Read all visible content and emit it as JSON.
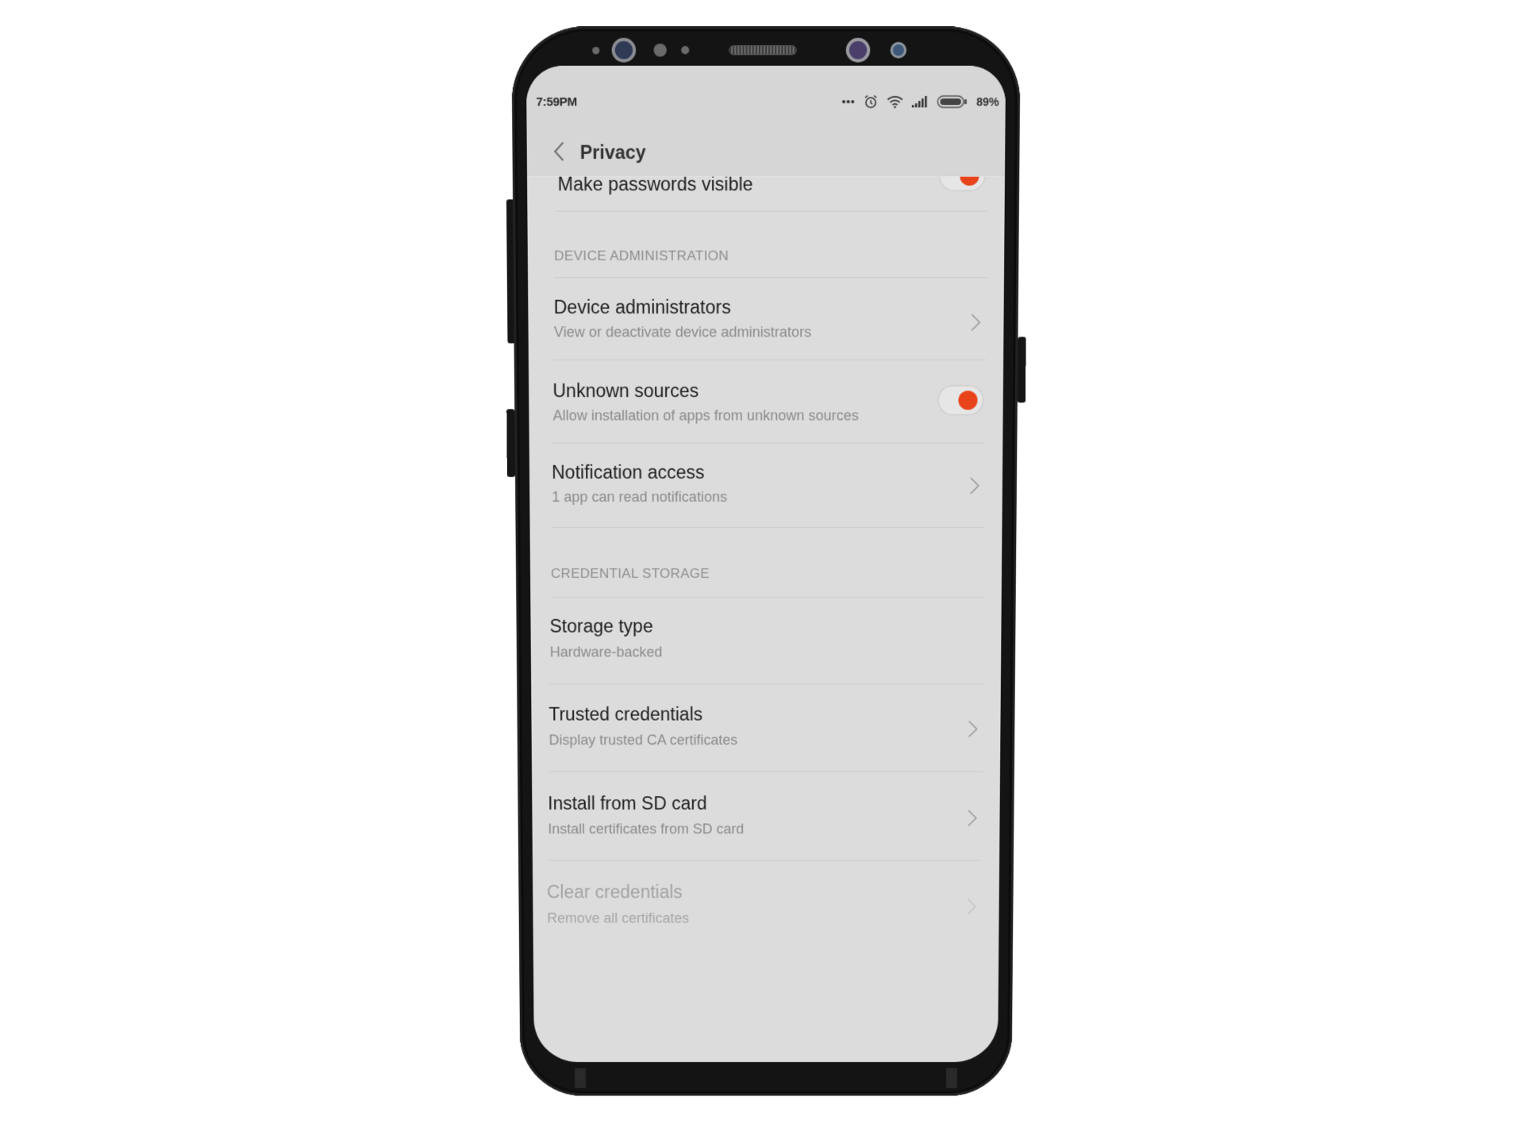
{
  "status_bar": {
    "time": "7:59PM",
    "icons": [
      "more-dots-icon",
      "alarm-icon",
      "wifi-icon",
      "signal-icon",
      "battery-icon"
    ],
    "battery_percent": "89%"
  },
  "header": {
    "back_icon": "chevron-left-icon",
    "title": "Privacy"
  },
  "colors": {
    "accent": "#e8441c",
    "screen_bg": "#dcdcdc",
    "header_bg": "#d6d6d6",
    "phone_body": "#141414"
  },
  "list": {
    "make_passwords_visible": {
      "title": "Make passwords visible",
      "toggle_on": true
    },
    "section_device_admin": "DEVICE ADMINISTRATION",
    "device_administrators": {
      "title": "Device administrators",
      "subtitle": "View or deactivate device administrators"
    },
    "unknown_sources": {
      "title": "Unknown sources",
      "subtitle": "Allow installation of apps from unknown sources",
      "toggle_on": true
    },
    "notification_access": {
      "title": "Notification access",
      "subtitle": "1 app can read notifications"
    },
    "section_credential_storage": "CREDENTIAL STORAGE",
    "storage_type": {
      "title": "Storage type",
      "subtitle": "Hardware-backed"
    },
    "trusted_credentials": {
      "title": "Trusted credentials",
      "subtitle": "Display trusted CA certificates"
    },
    "install_from_sd": {
      "title": "Install from SD card",
      "subtitle": "Install certificates from SD card"
    },
    "clear_credentials": {
      "title": "Clear credentials",
      "subtitle": "Remove all certificates",
      "enabled": false
    }
  }
}
